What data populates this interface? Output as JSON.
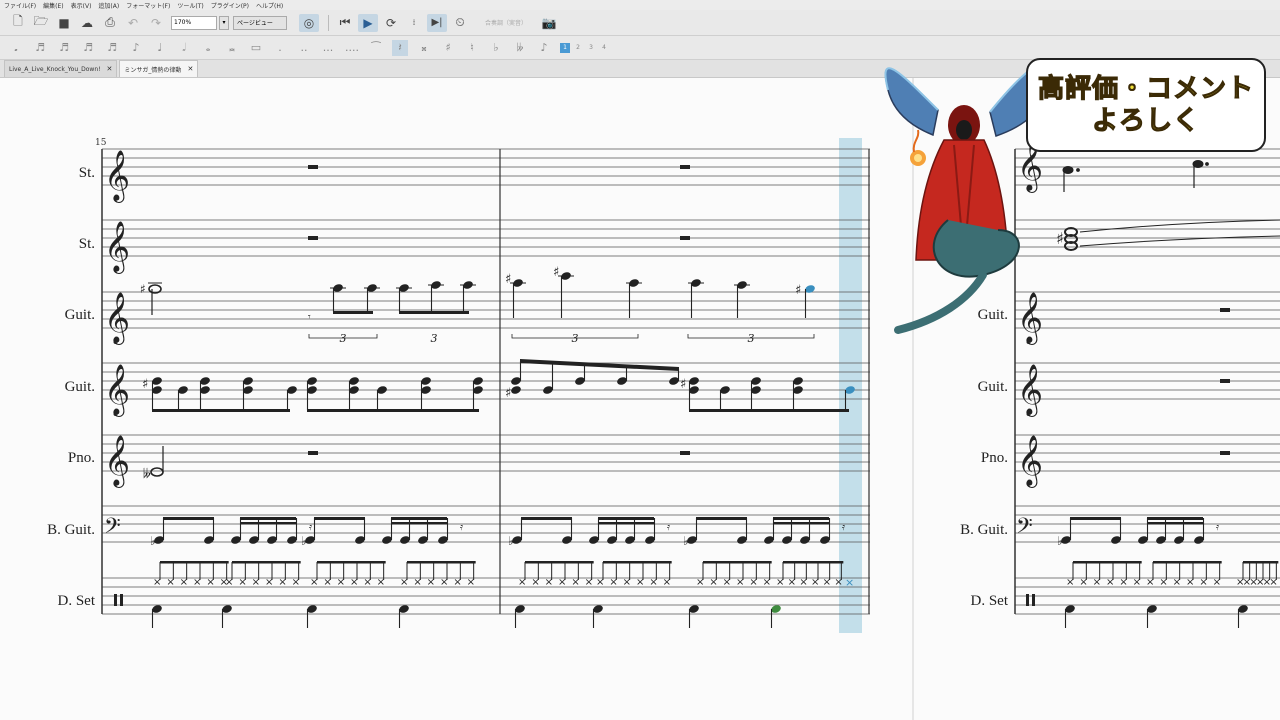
{
  "menu": [
    "ファイル(F)",
    "編集(E)",
    "表示(V)",
    "追加(A)",
    "フォーマット(F)",
    "ツール(T)",
    "プラグイン(P)",
    "ヘルプ(H)"
  ],
  "toolbar": {
    "zoom_value": "170%",
    "view_mode": "ページビュー",
    "concert_pitch": "合奏調（実音）"
  },
  "note_input": {
    "voices": [
      "1",
      "2",
      "3",
      "4"
    ]
  },
  "tabs": [
    {
      "label": "Live_A_Live_Knock_You_Down!"
    },
    {
      "label": "ミンサガ_情熱の律動"
    }
  ],
  "score": {
    "measure_number": "15",
    "instruments": [
      "St.",
      "St.",
      "Guit.",
      "Guit.",
      "Pno.",
      "B. Guit.",
      "D. Set"
    ],
    "instruments_right": [
      "Guit.",
      "Guit.",
      "Pno.",
      "B. Guit.",
      "D. Set"
    ],
    "tuplet_3": "3"
  },
  "promo": {
    "line1": "高評価・コメント",
    "line2": "よろしく"
  },
  "colors": {
    "playback_cursor": "#b9d9e6",
    "selected_note": "#3a8fbf",
    "green_note": "#3f8c3f",
    "mascot_red": "#c5281f",
    "mascot_wing": "#4f7fb4",
    "bubble_text": "#f2e23a"
  }
}
